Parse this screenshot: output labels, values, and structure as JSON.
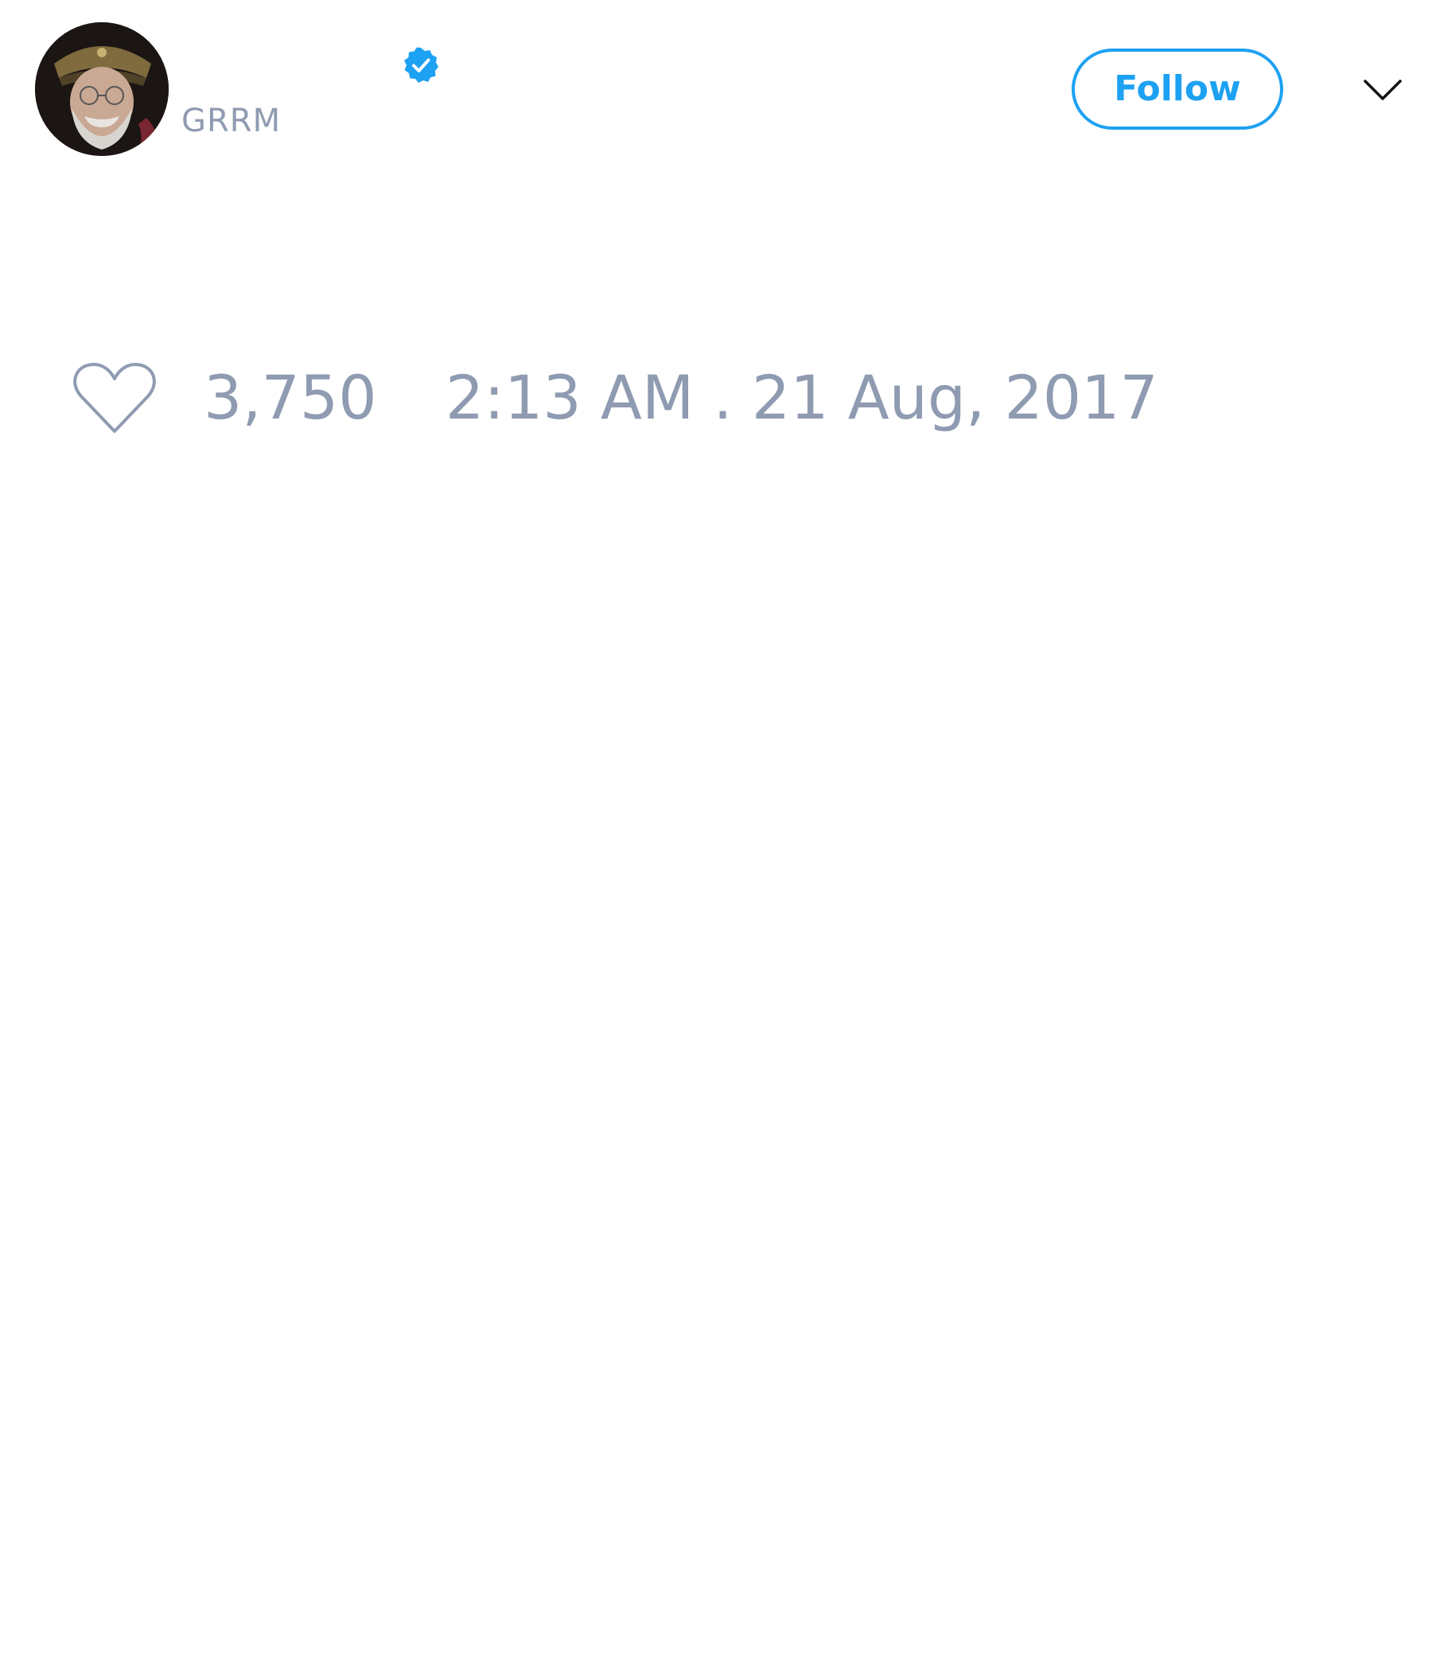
{
  "tweet": {
    "author": {
      "handle": "GRRM",
      "verified": true,
      "avatar_icon": "profile-photo-avatar"
    },
    "follow_label": "Follow",
    "menu_icon": "chevron-down-icon",
    "like_icon": "heart-outline-icon",
    "like_count": "3,750",
    "timestamp": "2:13 AM . 21 Aug, 2017"
  },
  "colors": {
    "accent": "#1da1f2",
    "muted_text": "#8f9bb1",
    "background": "#ffffff"
  }
}
